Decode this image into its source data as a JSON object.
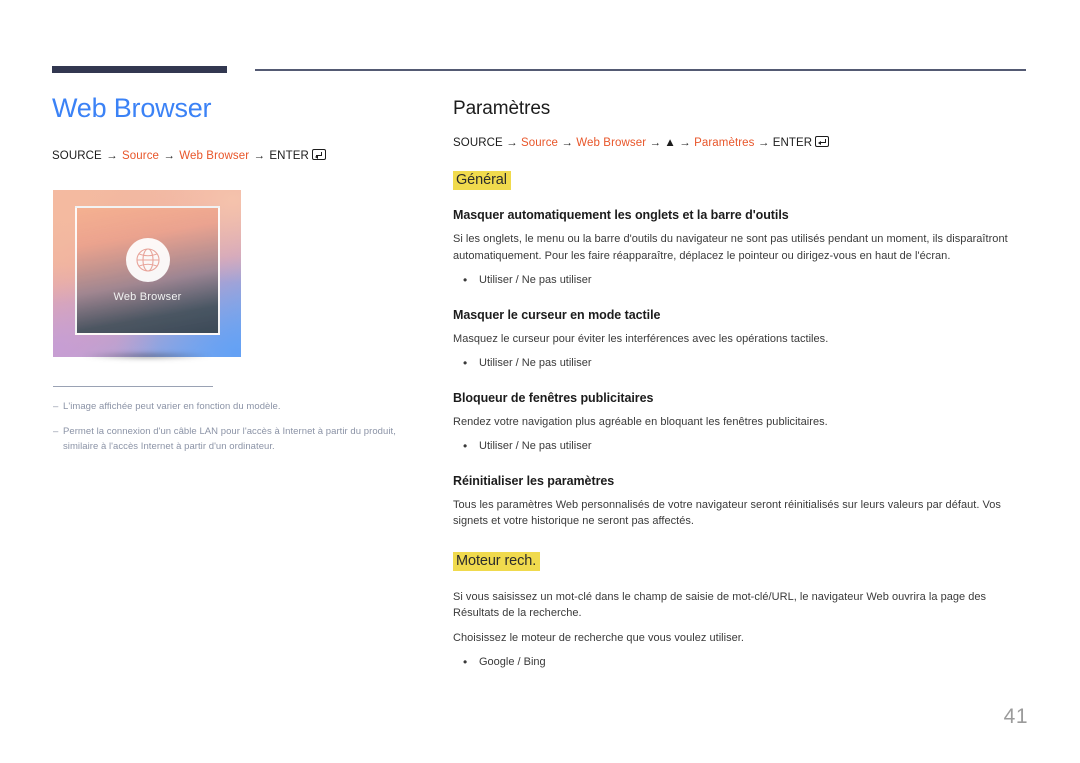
{
  "page": {
    "number": "41",
    "accent_blue": "#3b82f6",
    "accent_orange": "#e8562a",
    "highlight_yellow": "#f0da4d",
    "rule_navy": "#323750"
  },
  "left": {
    "title": "Web Browser",
    "breadcrumb": {
      "prefix": "SOURCE",
      "arrow": "→",
      "items": [
        "Source",
        "Web Browser"
      ],
      "enter_label": "ENTER",
      "enter_icon": "enter-key-icon"
    },
    "thumbnail": {
      "label": "Web Browser",
      "icon": "globe-icon"
    },
    "notes": [
      {
        "dash": "–",
        "text": "L'image affichée peut varier en fonction du modèle."
      },
      {
        "dash": "–",
        "text": "Permet la connexion d'un câble LAN pour l'accès à Internet à partir du produit, similaire à l'accès Internet à partir d'un ordinateur."
      }
    ]
  },
  "right": {
    "title": "Paramètres",
    "breadcrumb": {
      "prefix": "SOURCE",
      "arrow": "→",
      "item1": "Source",
      "item2": "Web Browser",
      "triangle": "▲",
      "item3": "Paramètres",
      "enter_label": "ENTER",
      "enter_icon": "enter-key-icon"
    },
    "section_general": {
      "heading": "Général",
      "items": [
        {
          "title": "Masquer automatiquement les onglets et la barre d'outils",
          "body": "Si les onglets, le menu ou la barre d'outils du navigateur ne sont pas utilisés pendant un moment, ils disparaîtront automatiquement. Pour les faire réapparaître, déplacez le pointeur ou dirigez-vous en haut de l'écran.",
          "options": [
            "Utiliser / Ne pas utiliser"
          ]
        },
        {
          "title": "Masquer le curseur en mode tactile",
          "body": "Masquez le curseur pour éviter les interférences avec les opérations tactiles.",
          "options": [
            "Utiliser / Ne pas utiliser"
          ]
        },
        {
          "title": "Bloqueur de fenêtres publicitaires",
          "body": "Rendez votre navigation plus agréable en bloquant les fenêtres publicitaires.",
          "options": [
            "Utiliser / Ne pas utiliser"
          ]
        },
        {
          "title": "Réinitialiser les paramètres",
          "body": "Tous les paramètres Web personnalisés de votre navigateur seront réinitialisés sur leurs valeurs par défaut. Vos signets et votre historique ne seront pas affectés.",
          "options": []
        }
      ]
    },
    "section_search": {
      "heading": "Moteur rech.",
      "body1": "Si vous saisissez un mot-clé dans le champ de saisie de mot-clé/URL, le navigateur Web ouvrira la page des Résultats de la recherche.",
      "body2": "Choisissez le moteur de recherche que vous voulez utiliser.",
      "options": [
        "Google / Bing"
      ]
    }
  }
}
